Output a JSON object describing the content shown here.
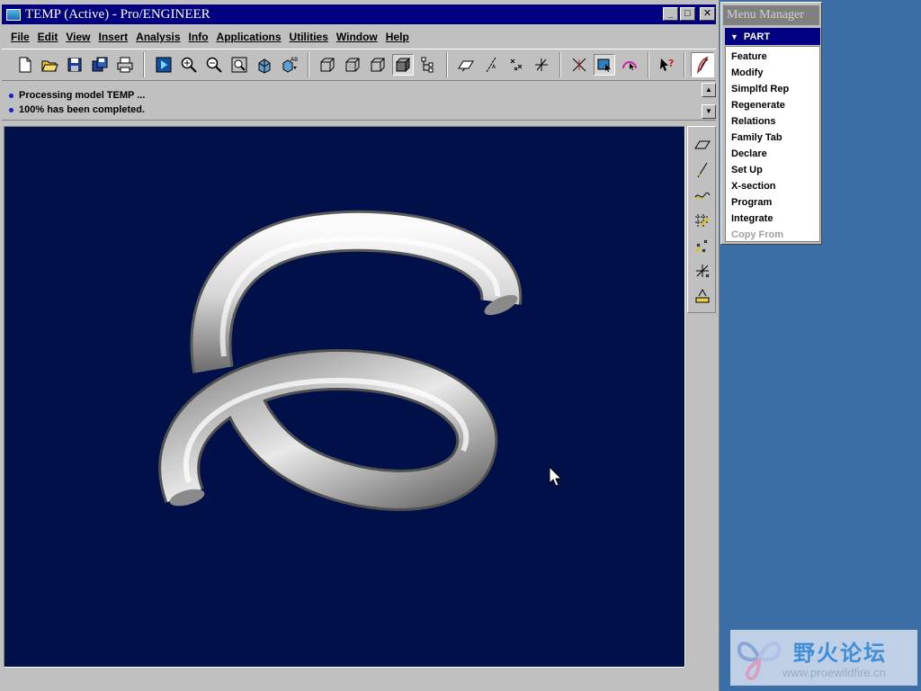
{
  "window": {
    "title": "TEMP (Active) - Pro/ENGINEER",
    "min_glyph": "_",
    "max_glyph": "□",
    "close_glyph": "✕"
  },
  "menu_bar": {
    "items": [
      "File",
      "Edit",
      "View",
      "Insert",
      "Analysis",
      "Info",
      "Applications",
      "Utilities",
      "Window",
      "Help"
    ]
  },
  "toolbar": {
    "icons": [
      "new-icon",
      "open-icon",
      "save-icon",
      "save-copy-icon",
      "print-icon",
      "repaint-icon",
      "zoom-in-icon",
      "zoom-out-icon",
      "refit-icon",
      "orient-icon",
      "saved-views-icon",
      "wireframe-icon",
      "hidden-line-icon",
      "no-hidden-icon",
      "shading-icon",
      "model-tree-icon",
      "datum-planes-icon",
      "datum-axes-icon",
      "datum-points-icon",
      "coord-sys-icon",
      "spin-center-icon",
      "selection-icon",
      "highlight-icon",
      "context-help-icon",
      "proe-logo-icon"
    ]
  },
  "messages": {
    "line1": "Processing model TEMP ...",
    "line2": "100% has been completed."
  },
  "right_toolbar": {
    "icons": [
      "datum-plane-tool-icon",
      "datum-axis-tool-icon",
      "datum-curve-tool-icon",
      "sketch-tool-icon",
      "datum-point-tool-icon",
      "coord-sys-tool-icon",
      "analysis-tool-icon"
    ]
  },
  "menu_manager": {
    "title": "Menu Manager",
    "header": "PART",
    "items": [
      {
        "label": "Feature",
        "enabled": true
      },
      {
        "label": "Modify",
        "enabled": true
      },
      {
        "label": "Simplfd Rep",
        "enabled": true
      },
      {
        "label": "Regenerate",
        "enabled": true
      },
      {
        "label": "Relations",
        "enabled": true
      },
      {
        "label": "Family Tab",
        "enabled": true
      },
      {
        "label": "Declare",
        "enabled": true
      },
      {
        "label": "Set Up",
        "enabled": true
      },
      {
        "label": "X-section",
        "enabled": true
      },
      {
        "label": "Program",
        "enabled": true
      },
      {
        "label": "Integrate",
        "enabled": true
      },
      {
        "label": "Copy From",
        "enabled": false
      }
    ]
  },
  "watermark": {
    "title": "野火论坛",
    "url": "www.proewildfire.cn"
  },
  "colors": {
    "title_bar": "#000080",
    "graphics_bg": "#00114a",
    "desktop": "#3a6ea5",
    "menu_header": "#000080"
  }
}
